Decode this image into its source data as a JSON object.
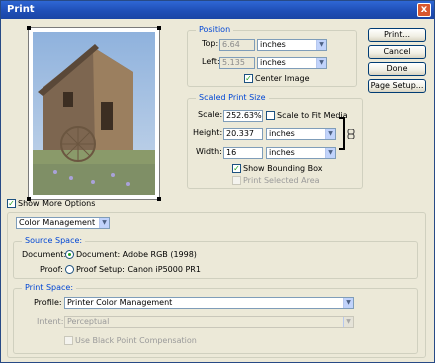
{
  "window": {
    "title": "Print",
    "close_label": "x"
  },
  "buttons": {
    "print": "Print...",
    "cancel": "Cancel",
    "done": "Done",
    "page_setup": "Page Setup..."
  },
  "position": {
    "title": "Position",
    "top_label": "Top:",
    "top_value": "6.64",
    "top_unit": "inches",
    "left_label": "Left:",
    "left_value": "5.135",
    "left_unit": "inches",
    "center_image": "Center Image",
    "center_image_checked": true
  },
  "scaled": {
    "title": "Scaled Print Size",
    "scale_label": "Scale:",
    "scale_value": "252.63%",
    "scale_to_fit": "Scale to Fit Media",
    "scale_to_fit_checked": false,
    "height_label": "Height:",
    "height_value": "20.337",
    "height_unit": "inches",
    "width_label": "Width:",
    "width_value": "16",
    "width_unit": "inches",
    "show_bounding_box": "Show Bounding Box",
    "show_bounding_box_checked": true,
    "print_selected_area": "Print Selected Area",
    "print_selected_area_checked": false
  },
  "more_options": {
    "label": "Show More Options",
    "checked": true
  },
  "management": {
    "dropdown": "Color Management",
    "source_space": {
      "title": "Source Space:",
      "document_label": "Document:",
      "document_option": "Document: Adobe RGB (1998)",
      "proof_label": "Proof:",
      "proof_option": "Proof Setup: Canon iP5000 PR1"
    },
    "print_space": {
      "title": "Print Space:",
      "profile_label": "Profile:",
      "profile_value": "Printer Color Management",
      "intent_label": "Intent:",
      "intent_value": "Perceptual",
      "black_point": "Use Black Point Compensation"
    }
  },
  "icons": {
    "chain": "chain-link-icon",
    "dropdown": "chevron-down-icon"
  },
  "colors": {
    "titlebar": "#2f67d4",
    "group_title": "#0046d5",
    "window_bg": "#ece9d8"
  }
}
